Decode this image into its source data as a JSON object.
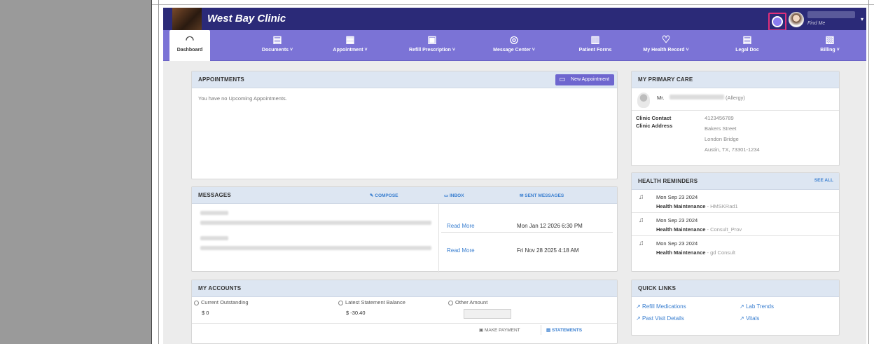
{
  "header": {
    "clinic_name": "West Bay Clinic",
    "user_sub": "Find Me"
  },
  "nav": {
    "dashboard": "Dashboard",
    "documents": "Documents ˅",
    "appointment": "Appointment ˅",
    "refill": "Refill Prescription ˅",
    "message_center": "Message Center ˅",
    "patient_forms": "Patient Forms",
    "health_record": "My Health Record ˅",
    "legal_doc": "Legal Doc",
    "billing": "Billing ˅"
  },
  "appointments": {
    "title": "APPOINTMENTS",
    "new_button": "New Appointment",
    "empty_text": "You have no Upcoming Appointments."
  },
  "messages": {
    "title": "MESSAGES",
    "compose": "COMPOSE",
    "inbox": "INBOX",
    "sent": "SENT MESSAGES",
    "rows": [
      {
        "read_more": "Read More",
        "date": "Mon Jan 12 2026 6:30 PM"
      },
      {
        "read_more": "Read More",
        "date": "Fri Nov 28 2025 4:18 AM"
      }
    ]
  },
  "accounts": {
    "title": "MY ACCOUNTS",
    "current_label": "Current Outstanding",
    "current_value": "$ 0",
    "latest_label": "Latest Statement Balance",
    "latest_value": "$ -30.40",
    "other_label": "Other Amount",
    "make_payment": "MAKE PAYMENT",
    "statements": "STATEMENTS"
  },
  "primary_care": {
    "title": "MY PRIMARY CARE",
    "doctor_prefix": "Mr.",
    "doctor_suffix": "(Allergy)",
    "contact_label": "Clinic Contact",
    "contact_value": "4123456789",
    "address_label": "Clinic Address",
    "address_line1": "Bakers Street",
    "address_line2": "London Bridge",
    "address_line3": "Austin, TX, 73301-1234"
  },
  "reminders": {
    "title": "HEALTH REMINDERS",
    "see_all": "SEE ALL",
    "items": [
      {
        "date": "Mon Sep 23 2024",
        "type": "Health Maintenance",
        "detail": "- HMSKRad1"
      },
      {
        "date": "Mon Sep 23 2024",
        "type": "Health Maintenance",
        "detail": "- Consult_Prov"
      },
      {
        "date": "Mon Sep 23 2024",
        "type": "Health Maintenance",
        "detail": "- gd Consult"
      }
    ]
  },
  "quick_links": {
    "title": "QUICK LINKS",
    "refill": "Refill Medications",
    "lab": "Lab Trends",
    "past_visit": "Past Visit Details",
    "vitals": "Vitals"
  },
  "colors": {
    "topbar": "#2b2a78",
    "navbar": "#7b73d6",
    "link": "#3a7fd0",
    "panel_header": "#dde6f2"
  }
}
